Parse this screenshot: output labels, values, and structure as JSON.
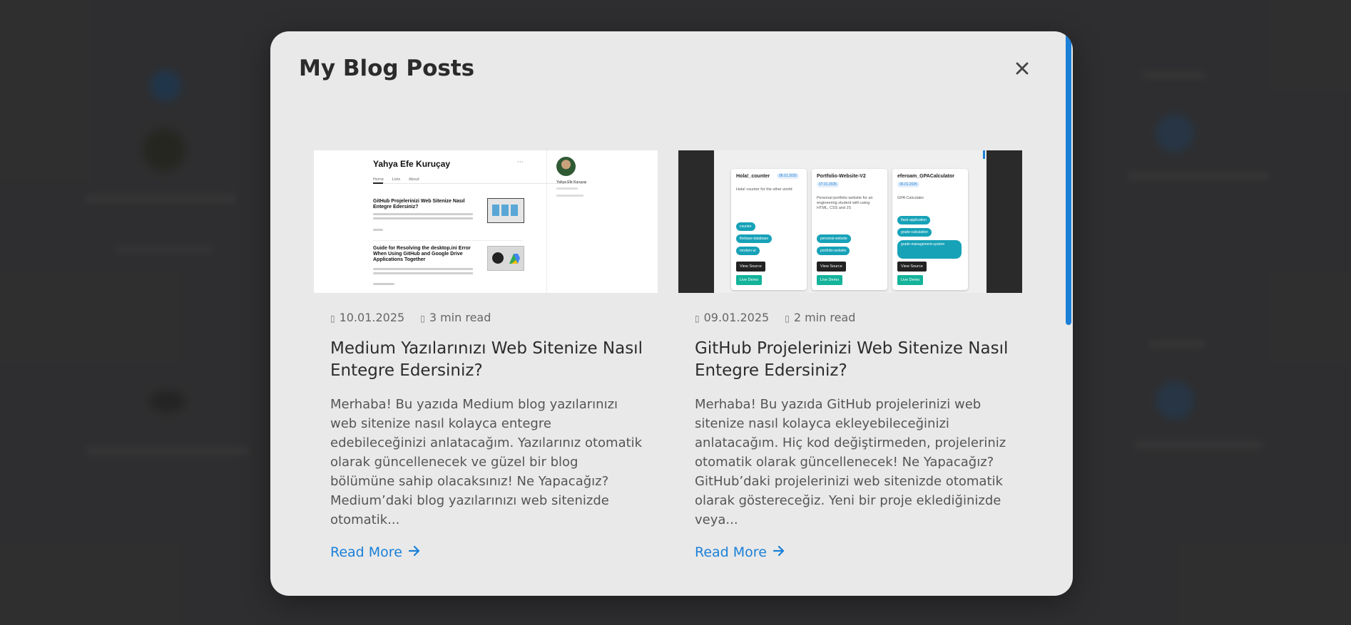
{
  "modal": {
    "title": "My Blog Posts",
    "close_symbol": "×"
  },
  "posts": [
    {
      "date": "10.01.2025",
      "read_time": "3 min read",
      "title": "Medium Yazılarınızı Web Sitenize Nasıl Entegre Edersiniz?",
      "excerpt": "Merhaba! Bu yazıda Medium blog yazılarınızı web sitenize nasıl kolayca entegre edebileceğinizi anlatacağım. Yazılarınız otomatik olarak güncellenecek ve güzel bir blog bölümüne sahip olacaksınız! Ne Yapacağız? Medium’daki blog yazılarınızı web sitenizde otomatik...",
      "read_more": "Read More",
      "thumbnail": {
        "author_name": "Yahya Efe Kuruçay",
        "tabs": [
          "Home",
          "Lists",
          "About"
        ],
        "items": [
          {
            "title": "GitHub Projelerinizi Web Sitenize Nasıl Entegre Edersiniz?"
          },
          {
            "title": "Guide for Resolving the desktop.ini Error When Using GitHub and Google Drive Applications Together"
          }
        ],
        "sidebar_name": "Yahya Efe Kuruçay"
      }
    },
    {
      "date": "09.01.2025",
      "read_time": "2 min read",
      "title": "GitHub Projelerinizi Web Sitenize Nasıl Entegre Edersiniz?",
      "excerpt": "Merhaba! Bu yazıda GitHub projelerinizi web sitenize nasıl kolayca ekleyebileceğinizi anlatacağım. Hiç kod değiştirmeden, projeleriniz otomatik olarak güncellenecek! Ne Yapacağız? GitHub’daki projelerinizi web sitenizde otomatik olarak göstereceğiz. Yeni bir proje eklediğinizde veya...",
      "read_more": "Read More",
      "thumbnail": {
        "projects": [
          {
            "name": "Hola!_counter",
            "date": "08.01.2025",
            "desc": "Hola! counter for the other world",
            "tags": [
              "counter",
              "firebase-database",
              "modern-ui"
            ],
            "source": "View Source",
            "demo": "Live Demo"
          },
          {
            "name": "Portfolio-Website-V2",
            "date": "07.01.2025",
            "desc": "Personal portfolio website for an engineering student with using HTML, CSS and JS",
            "tags": [
              "personal-website",
              "portfolio-website"
            ],
            "source": "View Source",
            "demo": "Live Demo"
          },
          {
            "name": "eferoam_GPACalculator",
            "date": "06.01.2025",
            "desc": "GPA Calculator",
            "tags": [
              "flask-application",
              "grade-calculation",
              "grade-management-system"
            ],
            "source": "View Source",
            "demo": "Live Demo"
          }
        ]
      }
    }
  ],
  "colors": {
    "accent": "#1b80d8",
    "modal_bg": "#e9e9e9",
    "backdrop": "#3a3a3b"
  }
}
